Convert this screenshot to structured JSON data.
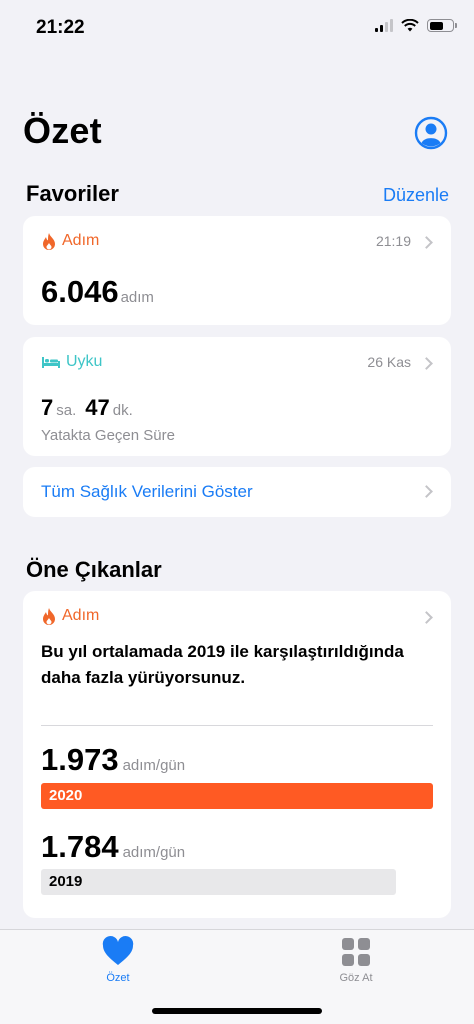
{
  "status_bar": {
    "time": "21:22"
  },
  "header": {
    "title": "Özet"
  },
  "favorites": {
    "title": "Favoriler",
    "edit_label": "Düzenle",
    "steps_card": {
      "label": "Adım",
      "time": "21:19",
      "value": "6.046",
      "unit": "adım"
    },
    "sleep_card": {
      "label": "Uyku",
      "date": "26 Kas",
      "hours": "7",
      "hours_unit": "sa.",
      "minutes": "47",
      "minutes_unit": "dk.",
      "caption": "Yatakta Geçen Süre"
    },
    "show_all_label": "Tüm Sağlık Verilerini Göster"
  },
  "highlights": {
    "title": "Öne Çıkanlar",
    "card": {
      "label": "Adım",
      "text": "Bu yıl ortalamada 2019 ile karşılaştırıldığında daha fazla yürüyorsunuz.",
      "stat_2020": {
        "value": "1.973",
        "unit": "adım/gün",
        "year": "2020"
      },
      "stat_2019": {
        "value": "1.784",
        "unit": "adım/gün",
        "year": "2019"
      }
    }
  },
  "tab_bar": {
    "summary_label": "Özet",
    "browse_label": "Göz At"
  },
  "colors": {
    "accent": "#1a7cf5",
    "activity": "#f0672a",
    "sleep": "#3ec5c7",
    "bar_2020": "#ff5a23",
    "bar_2019": "#e8e8ea"
  }
}
